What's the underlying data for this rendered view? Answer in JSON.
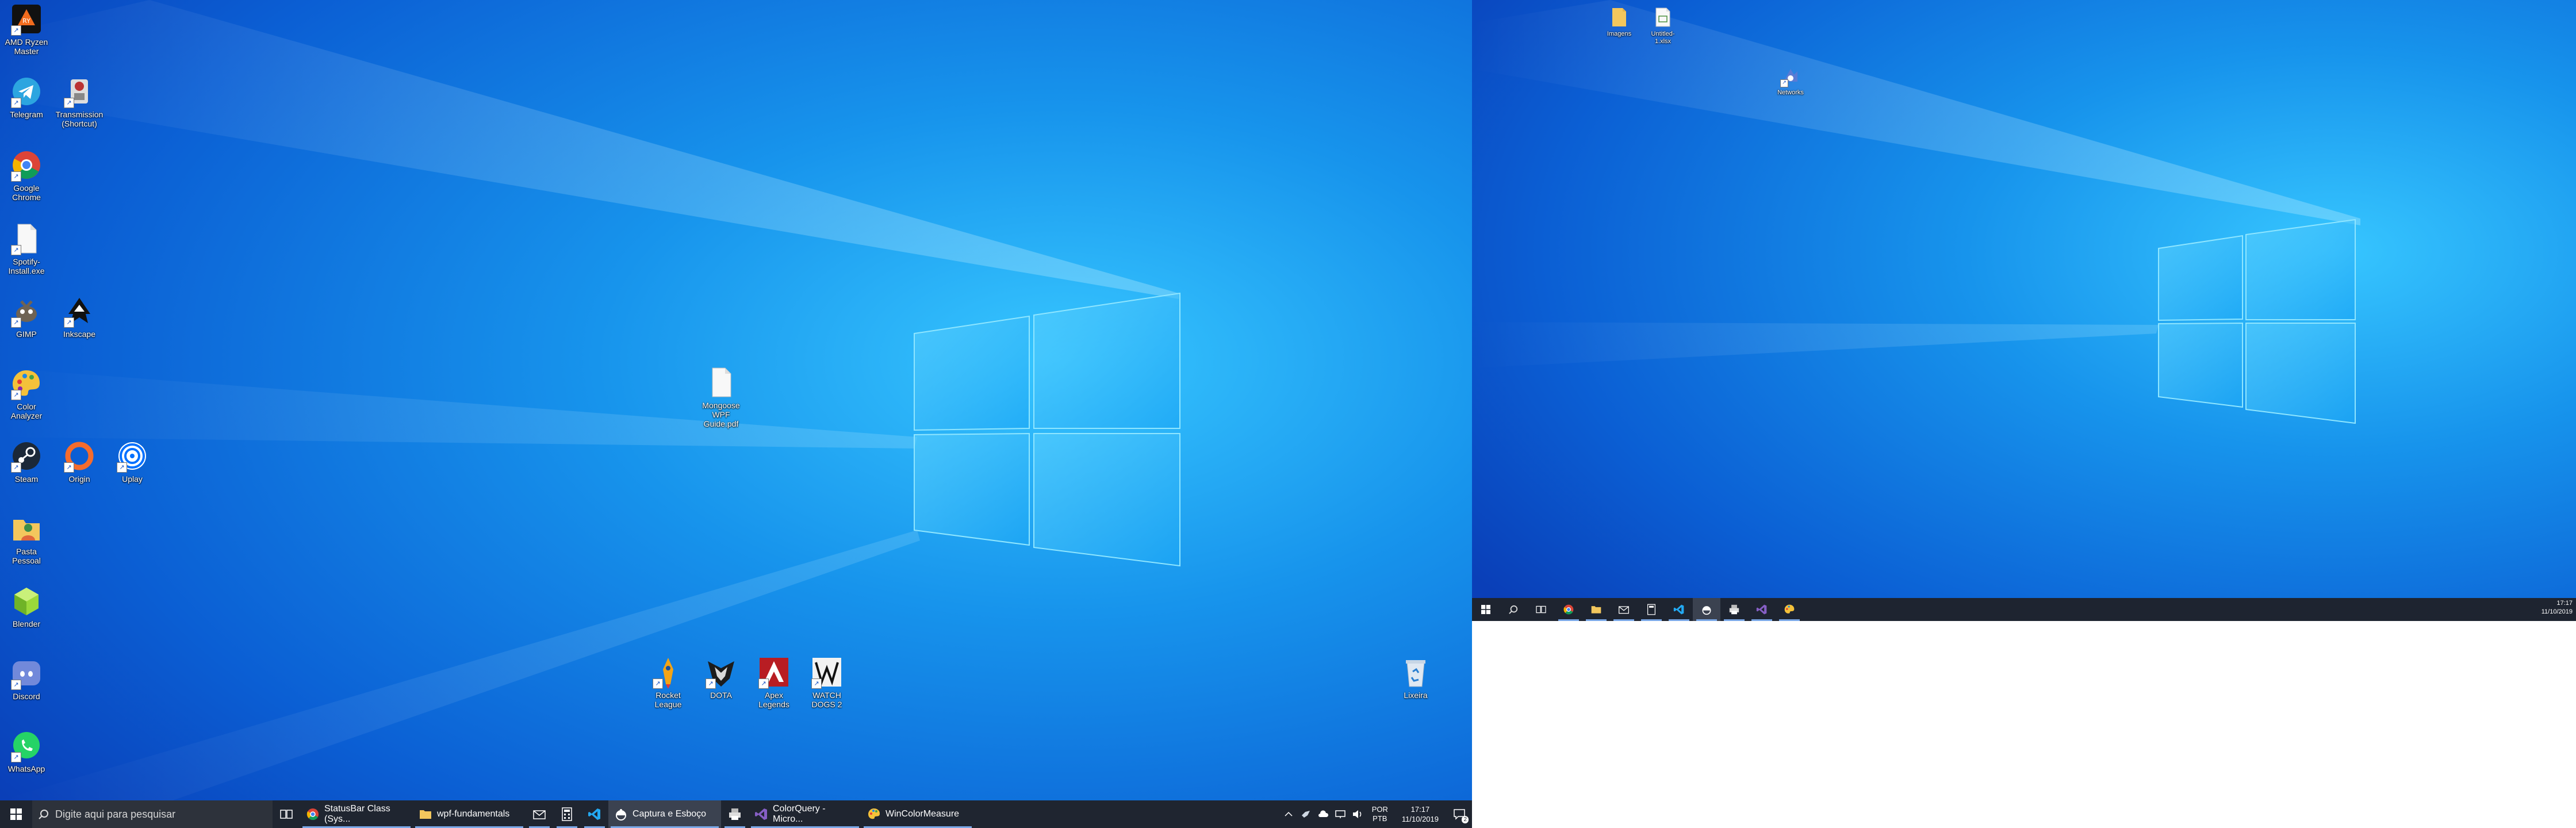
{
  "monitor1": {
    "desktop_icons": [
      {
        "name": "amd-ryzen-master",
        "label": "AMD Ryzen Master",
        "shortcut": true,
        "icon": "ryzen-icon"
      },
      {
        "name": "telegram",
        "label": "Telegram",
        "shortcut": true,
        "icon": "telegram-icon"
      },
      {
        "name": "transmission",
        "label": "Transmission (Shortcut)",
        "shortcut": true,
        "icon": "transmission-icon"
      },
      {
        "name": "google-chrome",
        "label": "Google Chrome",
        "shortcut": true,
        "icon": "chrome-icon"
      },
      {
        "name": "spotify-file",
        "label": "Spotify-Install.exe",
        "shortcut": true,
        "icon": "file-icon"
      },
      {
        "name": "gimp",
        "label": "GIMP",
        "shortcut": true,
        "icon": "gimp-icon"
      },
      {
        "name": "inkscape",
        "label": "Inkscape",
        "shortcut": true,
        "icon": "inkscape-icon"
      },
      {
        "name": "color-analyzer",
        "label": "Color Analyzer",
        "shortcut": true,
        "icon": "palette-icon"
      },
      {
        "name": "steam",
        "label": "Steam",
        "shortcut": true,
        "icon": "steam-icon"
      },
      {
        "name": "origin",
        "label": "Origin",
        "shortcut": true,
        "icon": "origin-icon"
      },
      {
        "name": "uplay",
        "label": "Uplay",
        "shortcut": true,
        "icon": "uplay-icon"
      },
      {
        "name": "pasta-pessoal",
        "label": "Pasta Pessoal",
        "shortcut": false,
        "icon": "user-folder-icon"
      },
      {
        "name": "blender",
        "label": "Blender",
        "shortcut": false,
        "icon": "cube-icon"
      },
      {
        "name": "discord",
        "label": "Discord",
        "shortcut": true,
        "icon": "discord-icon"
      },
      {
        "name": "whatsapp",
        "label": "WhatsApp",
        "shortcut": true,
        "icon": "whatsapp-icon"
      },
      {
        "name": "middle-file",
        "label": "Mongoose WPF Guide.pdf",
        "shortcut": false,
        "icon": "file-icon"
      },
      {
        "name": "rocket-league",
        "label": "Rocket League",
        "shortcut": true,
        "icon": "rocket-icon"
      },
      {
        "name": "dota",
        "label": "DOTA",
        "shortcut": true,
        "icon": "dota-icon"
      },
      {
        "name": "apex-legends",
        "label": "Apex Legends",
        "shortcut": true,
        "icon": "apex-icon"
      },
      {
        "name": "watch-dogs",
        "label": "WATCH DOGS 2",
        "shortcut": true,
        "icon": "watchdogs-icon"
      },
      {
        "name": "lixeira",
        "label": "Lixeira",
        "shortcut": false,
        "icon": "recycle-bin-icon"
      }
    ],
    "taskbar": {
      "search_placeholder": "Digite aqui para pesquisar",
      "apps": [
        {
          "label": "StatusBar Class (Sys...",
          "icon": "chrome-icon",
          "state": "running"
        },
        {
          "label": "wpf-fundamentals",
          "icon": "folder-icon",
          "state": "running"
        },
        {
          "label": "Captura e Esboço",
          "icon": "snip-icon",
          "state": "active"
        },
        {
          "label": "ColorQuery - Micro...",
          "icon": "visual-studio-icon",
          "state": "running"
        },
        {
          "label": "WinColorMeasure",
          "icon": "palette-icon",
          "state": "running"
        }
      ],
      "pinned": [
        "mail-icon",
        "calculator-icon",
        "vscode-icon",
        "printer-icon"
      ],
      "language": {
        "top": "POR",
        "bottom": "PTB"
      },
      "time": "17:17",
      "date": "11/10/2019",
      "notification_count": "2"
    }
  },
  "monitor2": {
    "desktop_icons": [
      {
        "name": "folder-m2",
        "label": "Imagens",
        "shortcut": false,
        "icon": "folder-icon"
      },
      {
        "name": "file-m2",
        "label": "Untitled-1.xlsx",
        "shortcut": false,
        "icon": "file-icon"
      },
      {
        "name": "app-m2",
        "label": "Networks",
        "shortcut": true,
        "icon": "network-icon"
      }
    ],
    "taskbar": {
      "time": "17:17",
      "date": "11/10/2019"
    }
  },
  "colors": {
    "wallpaper_dark": "#0a3fb8",
    "wallpaper_light": "#1d9ff0",
    "taskbar": "#1f2530",
    "accent": "#7aa7e6"
  }
}
